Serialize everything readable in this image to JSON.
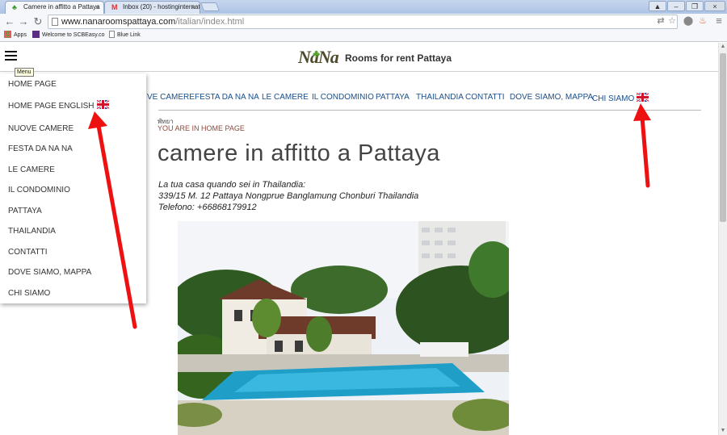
{
  "browser": {
    "tabs": [
      {
        "title": "Camere in affitto a Pattaya",
        "icon": "palm-tree-icon",
        "active": true
      },
      {
        "title": "Inbox (20) - hostinginternati",
        "icon": "gmail-icon",
        "active": false
      }
    ],
    "tab_close": "×",
    "window_controls": {
      "user": "▲",
      "minimize": "–",
      "restore": "❐",
      "close": "×"
    },
    "nav": {
      "back": "←",
      "forward": "→",
      "reload": "↻"
    },
    "url_host": "www.nanaroomspattaya.com",
    "url_path": "/italian/index.html",
    "omnibox_icons": {
      "translate": "⇄",
      "star": "☆",
      "extension1": "⬤",
      "extension2": "♨",
      "menu": "≡"
    },
    "bookmarks": [
      {
        "label": "Apps",
        "icon": "apps-grid-icon"
      },
      {
        "label": "Welcome to SCBEasy.co",
        "icon": "scb-icon"
      },
      {
        "label": "Blue Link",
        "icon": "page-icon"
      }
    ],
    "scrollbar": {
      "up": "▲",
      "down": "▼"
    }
  },
  "site": {
    "logo_text": "NaNa",
    "logo_palm": "🌴",
    "title": "Rooms for rent Pattaya",
    "menu_tooltip": "Menu",
    "dropdown_items": [
      "HOME PAGE",
      "HOME PAGE ENGLISH",
      "NUOVE CAMERE",
      "FESTA DA NA NA",
      "LE CAMERE",
      "IL CONDOMINIO",
      "PATTAYA",
      "THAILANDIA",
      "CONTATTI",
      "DOVE SIAMO, MAPPA",
      "CHI SIAMO"
    ],
    "top_nav": [
      "VE CAMERE",
      "FESTA DA NA NA",
      "LE CAMERE",
      "IL CONDOMINIO",
      "PATTAYA",
      "THAILANDIA",
      "CONTATTI",
      "DOVE SIAMO, MAPPA",
      "CHI SIAMO"
    ],
    "thai_word": "พัทยา",
    "you_are_here": "YOU ARE IN HOME PAGE",
    "heading": "camere in affitto a Pattaya",
    "address_lines": [
      "La tua casa quando sei in Thailandia:",
      "339/15 M. 12 Pattaya Nongprue Banglamung Chonburi Thailandia",
      "Telefono: +66868179912"
    ],
    "link_color": "#1a4f8a",
    "accent_arrow_color": "#ee1111"
  }
}
